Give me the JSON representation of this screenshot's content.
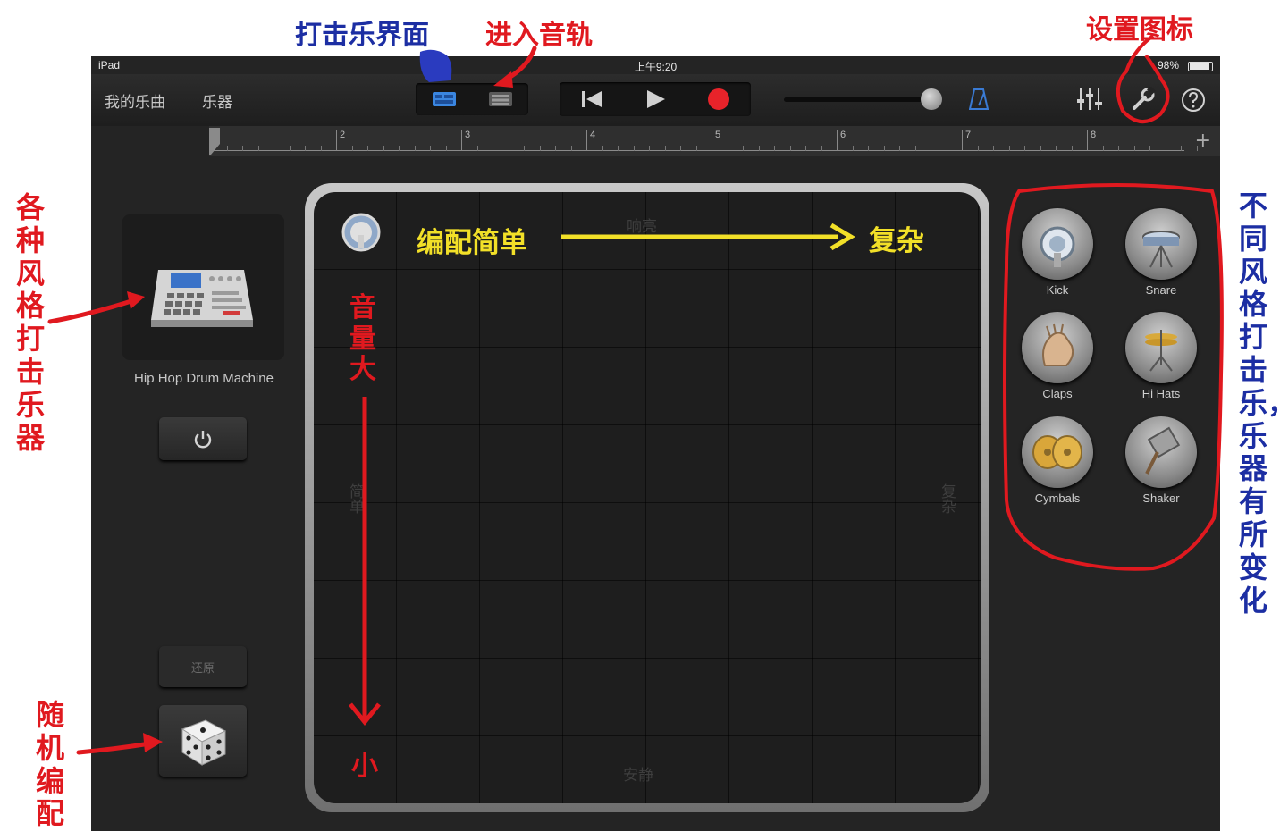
{
  "status_bar": {
    "device": "iPad",
    "time": "上午9:20",
    "battery": "98%"
  },
  "toolbar": {
    "my_songs": "我的乐曲",
    "instruments": "乐器"
  },
  "ruler": {
    "bars": [
      "2",
      "3",
      "4",
      "5",
      "6",
      "7",
      "8"
    ],
    "add": "+"
  },
  "drummer": {
    "name": "Hip Hop Drum Machine",
    "restore": "还原"
  },
  "pad": {
    "hint_top": "响亮",
    "hint_bottom": "安静",
    "hint_left": "简单",
    "hint_right": "复杂"
  },
  "instruments": [
    {
      "name": "Kick",
      "icon": "kick-drum-icon"
    },
    {
      "name": "Snare",
      "icon": "snare-drum-icon"
    },
    {
      "name": "Claps",
      "icon": "claps-hand-icon"
    },
    {
      "name": "Hi Hats",
      "icon": "hi-hats-icon"
    },
    {
      "name": "Cymbals",
      "icon": "cymbals-icon"
    },
    {
      "name": "Shaker",
      "icon": "shaker-icon"
    }
  ],
  "annotations": {
    "drum_view": "打击乐界面",
    "enter_tracks": "进入音轨",
    "settings_icon": "设置图标",
    "styles": "各种风格打击乐器",
    "instrument_change": "不同风格打击乐，乐器有所变化",
    "random_arrange": "随机编配",
    "simple": "编配简单",
    "complex": "复杂",
    "loud": "音量大",
    "soft": "小"
  },
  "colors": {
    "annotation_red": "#e0191f",
    "annotation_blue": "#1c2ea3",
    "annotation_yellow": "#f2e028",
    "record": "#e8232a",
    "accent_blue": "#3a7bd5"
  }
}
